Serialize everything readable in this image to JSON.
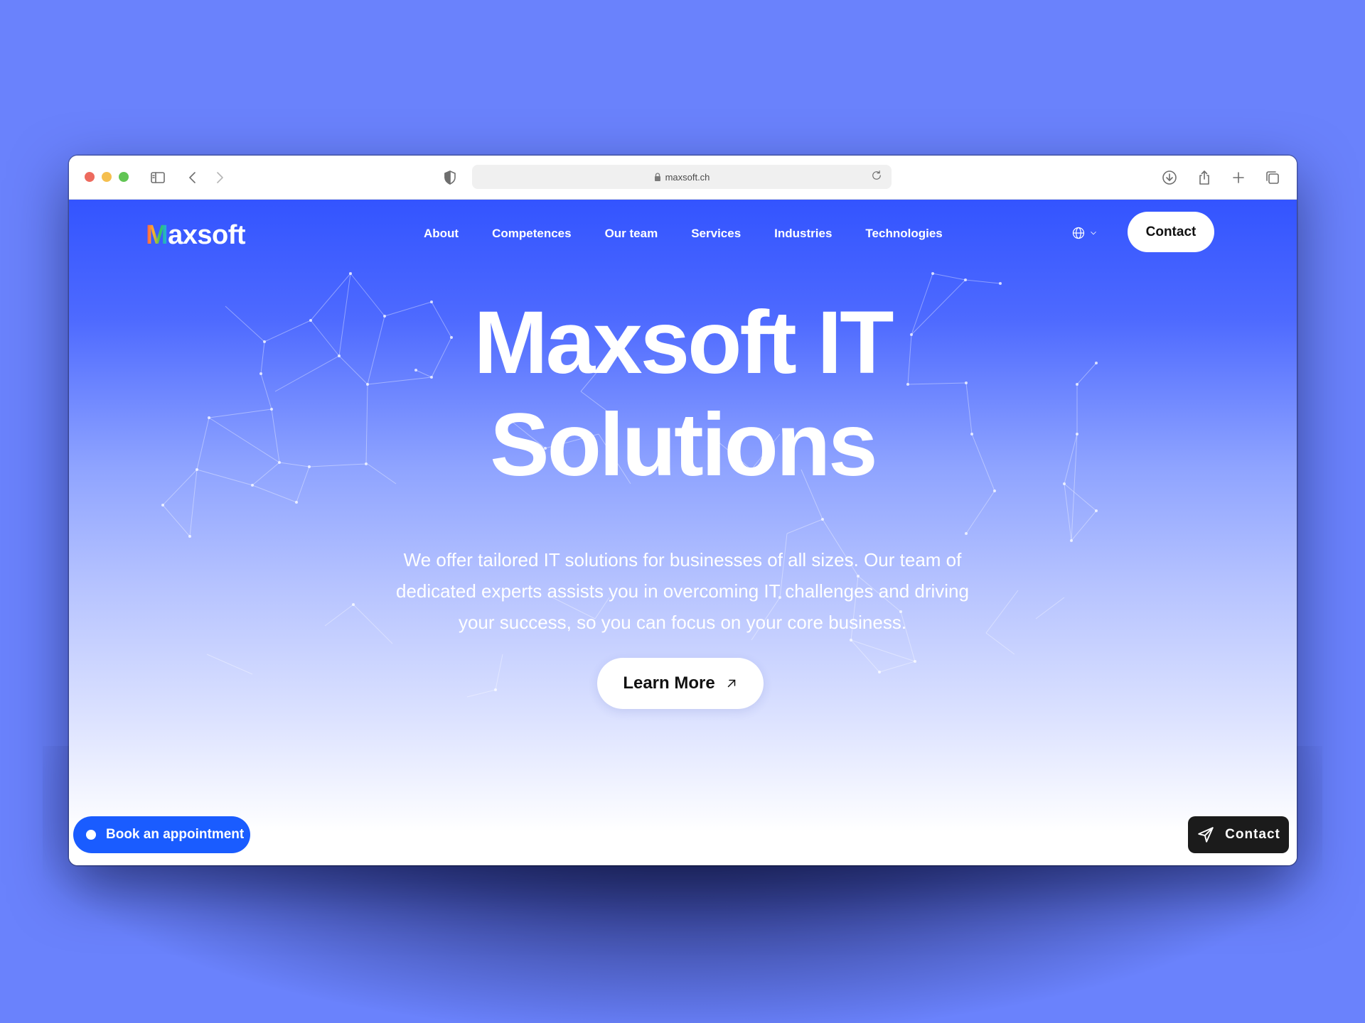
{
  "browser": {
    "url": "maxsoft.ch"
  },
  "site": {
    "logo_initial": "M",
    "logo_rest": "axsoft",
    "nav": [
      {
        "label": "About"
      },
      {
        "label": "Competences"
      },
      {
        "label": "Our team"
      },
      {
        "label": "Services"
      },
      {
        "label": "Industries"
      },
      {
        "label": "Technologies"
      }
    ],
    "contact_label": "Contact"
  },
  "hero": {
    "title_line1": "Maxsoft IT",
    "title_line2": "Solutions",
    "description": "We offer tailored IT solutions for businesses of all sizes. Our team of dedicated experts assists you in overcoming IT challenges and driving your success, so you can focus on your core business.",
    "cta_label": "Learn More"
  },
  "floating": {
    "book_label": "Book an appointment",
    "contact_label": "Contact"
  },
  "colors": {
    "page_background": "#6a82fc",
    "hero_top": "#3354ff",
    "book_button": "#1a5cff",
    "contact_float": "#1b1b1b"
  },
  "icons": [
    "sidebar-icon",
    "back-icon",
    "forward-icon",
    "shield-icon",
    "lock-icon",
    "reload-icon",
    "download-icon",
    "share-icon",
    "new-tab-icon",
    "tabs-overview-icon",
    "globe-icon",
    "chevron-down-icon",
    "arrow-up-right-icon",
    "send-icon"
  ]
}
